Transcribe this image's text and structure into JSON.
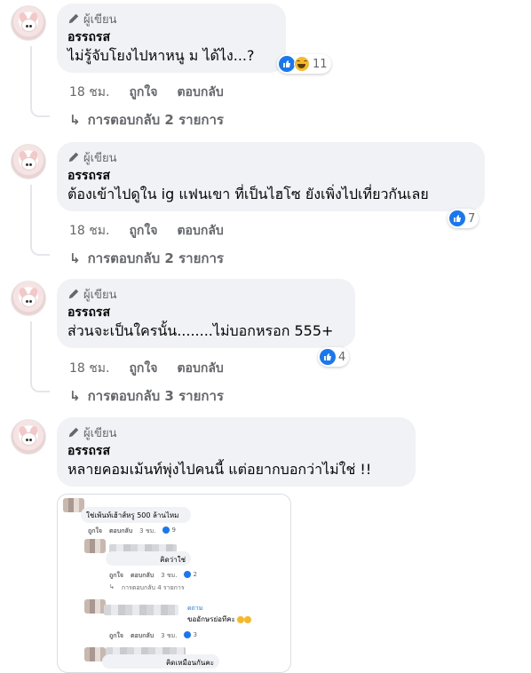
{
  "comments": [
    {
      "badge": "ผู้เขียน",
      "author": "อรรถรส",
      "text": "ไม่รู้จับโยงไปหาหนู ม ได้ไง...?",
      "reaction_count": "11",
      "reaction_types": [
        "like-icon",
        "haha-icon"
      ],
      "time": "18 ชม.",
      "like": "ถูกใจ",
      "reply": "ตอบกลับ",
      "replies": "การตอบกลับ 2 รายการ"
    },
    {
      "badge": "ผู้เขียน",
      "author": "อรรถรส",
      "text": "ต้องเข้าไปดูใน ig แฟนเขา ที่เป็นไฮโซ ยังเพิ่งไปเที่ยวกันเลย",
      "reaction_count": "7",
      "reaction_types": [
        "like-icon"
      ],
      "time": "18 ชม.",
      "like": "ถูกใจ",
      "reply": "ตอบกลับ",
      "replies": "การตอบกลับ 2 รายการ"
    },
    {
      "badge": "ผู้เขียน",
      "author": "อรรถรส",
      "text": "ส่วนจะเป็นใครนั้น........ไม่บอกหรอก 555+",
      "reaction_count": "4",
      "reaction_types": [
        "like-icon"
      ],
      "time": "18 ชม.",
      "like": "ถูกใจ",
      "reply": "ตอบกลับ",
      "replies": "การตอบกลับ 3 รายการ"
    },
    {
      "badge": "ผู้เขียน",
      "author": "อรรถรส",
      "text": "หลายคอมเม้นท์พุ่งไปคนนี้ แต่อยากบอกว่าไม่ใช่ !!"
    }
  ],
  "embedded": {
    "c1_text": "ใช่เพ้นท์เฮ้าส์หรู 500 ล้านไหม",
    "c1_actions": [
      "ถูกใจ",
      "ตอบกลับ",
      "3 ชม."
    ],
    "c1_count": "9",
    "c2_text": "คิดว่าใช่",
    "c2_actions": [
      "ถูกใจ",
      "ตอบกลับ",
      "3 ชม."
    ],
    "c2_count": "2",
    "c2_replies": "การตอบกลับ 4 รายการ",
    "c3_name": "ดถาม",
    "c3_text": "ขออักษรย่อทีคะ",
    "c3_actions": [
      "ถูกใจ",
      "ตอบกลับ",
      "3 ชม."
    ],
    "c3_count": "3",
    "c4_text": "คิดเหมือนกันคะ"
  },
  "colors": {
    "like": "#1877f2",
    "haha": "#f7b928",
    "bubble": "#f0f2f5",
    "secondary_text": "#65676b"
  }
}
